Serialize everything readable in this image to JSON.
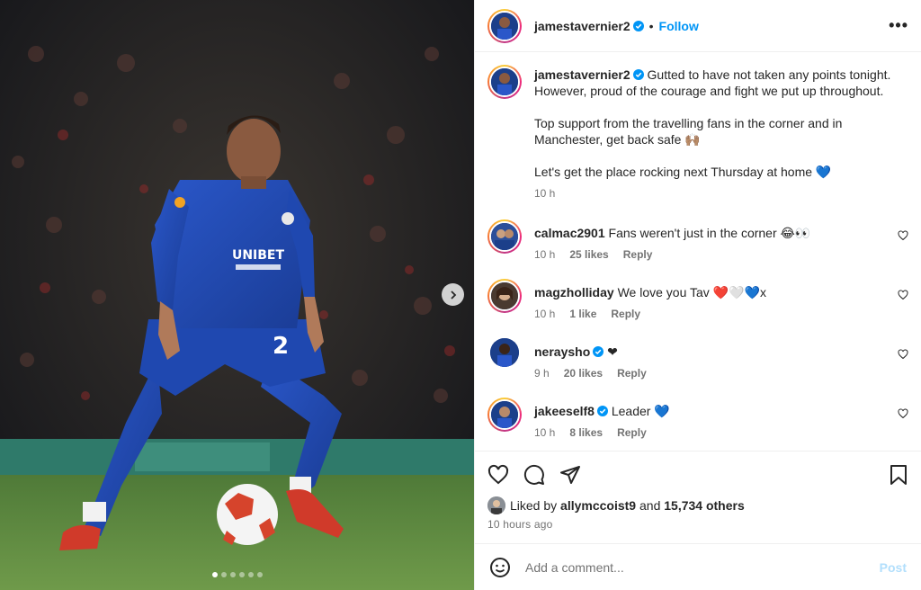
{
  "post": {
    "author": "jamestavernier2",
    "follow_label": "Follow",
    "more_label": "•••",
    "caption_lines": [
      "Gutted to have not taken any points tonight. However, proud of the courage and fight we put up throughout.",
      "Top support from the travelling fans in the corner and in Manchester, get back safe 🙌🏽",
      "Let's get the place rocking next Thursday at home 💙"
    ],
    "caption_time": "10 h",
    "carousel": {
      "count": 6,
      "active_index": 0
    },
    "shirt_sponsor": "UNIBET",
    "shirt_number": "2"
  },
  "comments": [
    {
      "user": "calmac2901",
      "verified": false,
      "text": "Fans weren't just in the corner 😂👀",
      "time": "10 h",
      "likes": "25 likes",
      "reply": "Reply"
    },
    {
      "user": "magzholliday",
      "verified": false,
      "text": "We love you Tav ❤️🤍💙x",
      "time": "10 h",
      "likes": "1 like",
      "reply": "Reply"
    },
    {
      "user": "neraysho",
      "verified": true,
      "text": "❤",
      "time": "9 h",
      "likes": "20 likes",
      "reply": "Reply"
    },
    {
      "user": "jakeeself8",
      "verified": true,
      "text": "Leader 💙",
      "time": "10 h",
      "likes": "8 likes",
      "reply": "Reply"
    }
  ],
  "footer": {
    "liked_prefix": "Liked by",
    "liked_user": "allymccoist9",
    "liked_and": "and",
    "liked_others": "15,734 others",
    "time_ago": "10 hours ago",
    "comment_placeholder": "Add a comment...",
    "post_label": "Post"
  },
  "colors": {
    "link": "#0095f6",
    "muted": "#737373",
    "post_disabled": "#b2dffc"
  }
}
